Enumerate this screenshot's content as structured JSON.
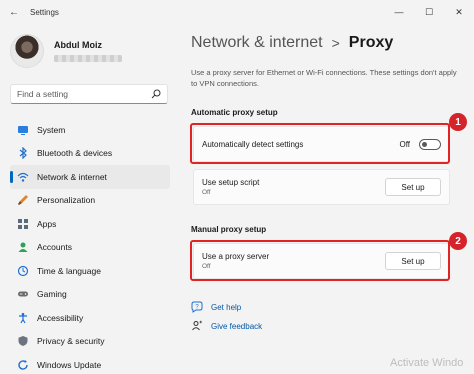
{
  "window": {
    "title": "Settings",
    "back_glyph": "←",
    "min_glyph": "—",
    "max_glyph": "☐",
    "close_glyph": "✕"
  },
  "profile": {
    "name": "Abdul Moiz"
  },
  "search": {
    "placeholder": "Find a setting",
    "icon": "search-icon"
  },
  "sidebar": {
    "items": [
      {
        "label": "System",
        "icon": "monitor-icon"
      },
      {
        "label": "Bluetooth & devices",
        "icon": "bluetooth-icon"
      },
      {
        "label": "Network & internet",
        "icon": "wifi-icon",
        "active": true
      },
      {
        "label": "Personalization",
        "icon": "brush-icon"
      },
      {
        "label": "Apps",
        "icon": "apps-icon"
      },
      {
        "label": "Accounts",
        "icon": "person-icon"
      },
      {
        "label": "Time & language",
        "icon": "globe-clock-icon"
      },
      {
        "label": "Gaming",
        "icon": "gamepad-icon"
      },
      {
        "label": "Accessibility",
        "icon": "accessibility-icon"
      },
      {
        "label": "Privacy & security",
        "icon": "shield-icon"
      },
      {
        "label": "Windows Update",
        "icon": "update-icon"
      }
    ]
  },
  "header": {
    "parent": "Network & internet",
    "separator": ">",
    "current": "Proxy"
  },
  "description": "Use a proxy server for Ethernet or Wi-Fi connections. These settings don't apply to VPN connections.",
  "automatic": {
    "heading": "Automatic proxy setup",
    "detect": {
      "label": "Automatically detect settings",
      "state_label": "Off",
      "on": false,
      "badge": "1"
    },
    "script": {
      "label": "Use setup script",
      "sub": "Off",
      "button": "Set up"
    }
  },
  "manual": {
    "heading": "Manual proxy setup",
    "server": {
      "label": "Use a proxy server",
      "sub": "Off",
      "button": "Set up",
      "badge": "2"
    }
  },
  "links": {
    "help": "Get help",
    "feedback": "Give feedback"
  },
  "watermark": "Activate Windo",
  "colors": {
    "accent": "#0067c0",
    "highlight": "#e02424",
    "badge": "#d4232a",
    "link": "#0058a8"
  }
}
